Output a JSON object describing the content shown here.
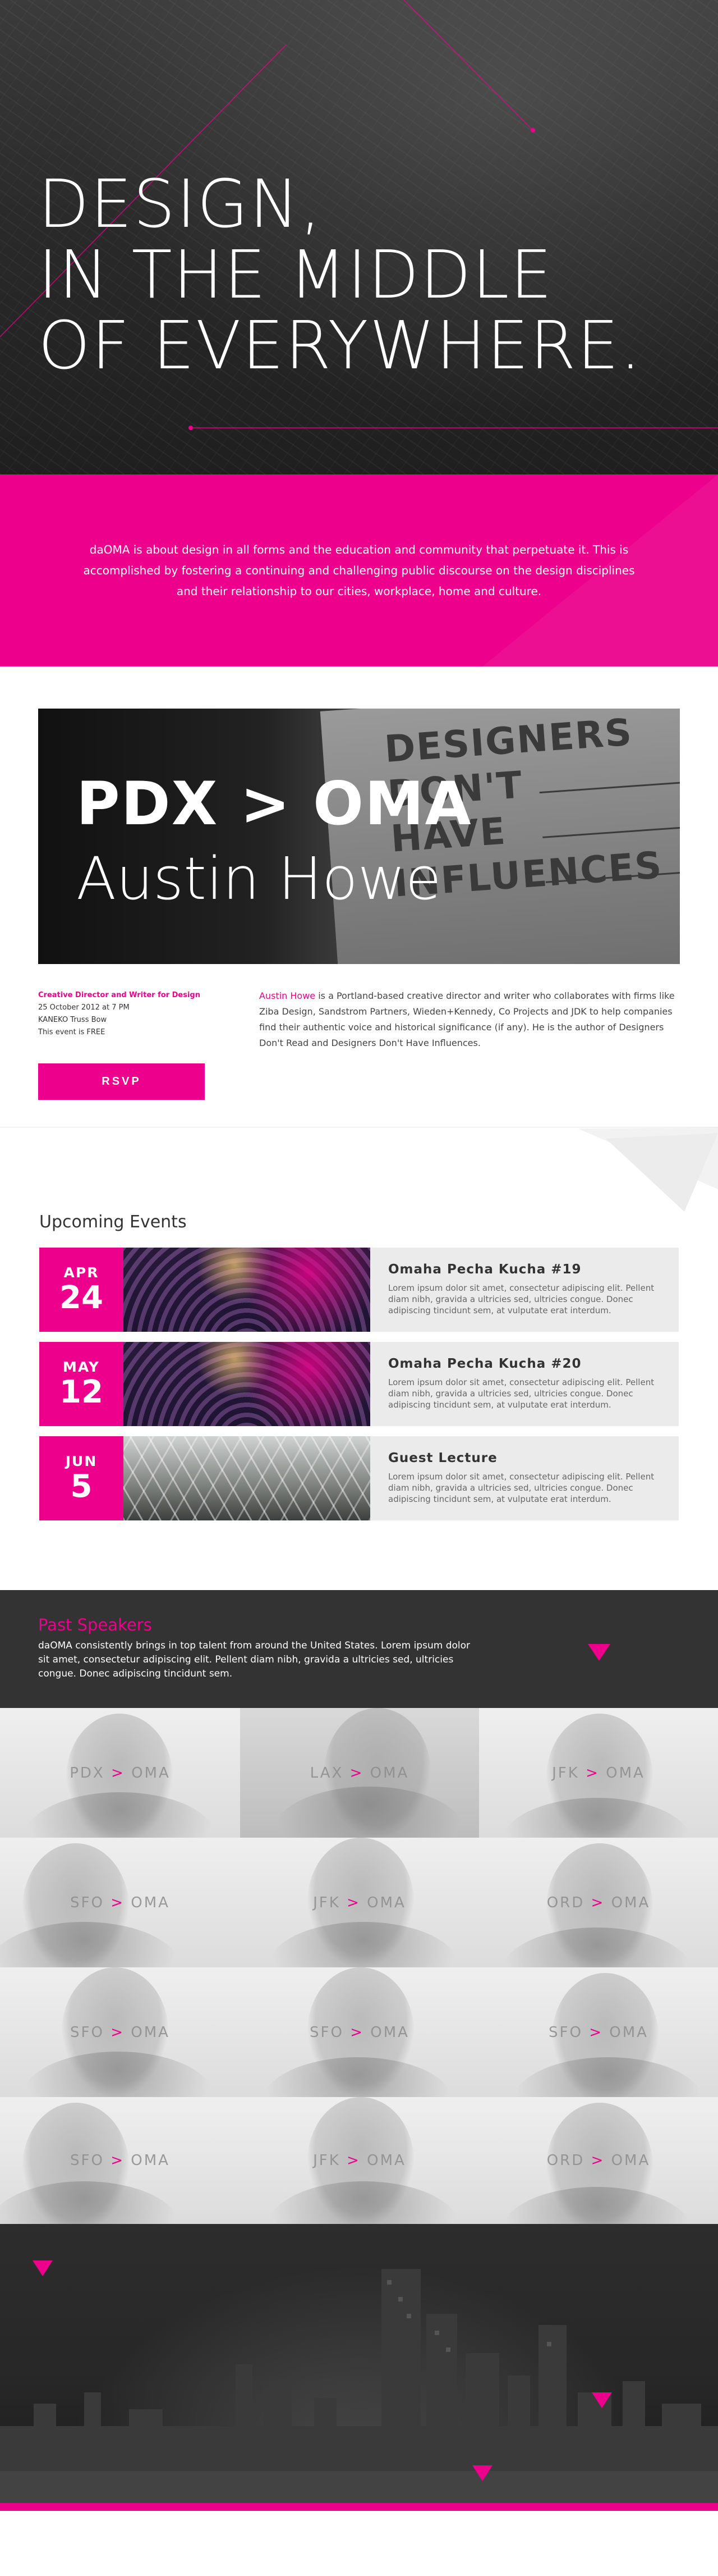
{
  "hero": {
    "line1": "DESIGN,",
    "line2": "IN THE MIDDLE",
    "line3": "OF EVERYWHERE."
  },
  "mission": {
    "text": "daOMA is about design in all forms and the education and community that perpetuate it. This is accomplished by fostering a continuing and challenging public discourse on the design disciplines and their relationship to our cities, workplace, home and culture."
  },
  "feature": {
    "title": "PDX > OMA",
    "speaker": "Austin Howe",
    "sign_words": [
      "DESIGNERS",
      "DON'T",
      "HAVE",
      "INFLUENCES"
    ],
    "role": "Creative Director and Writer for Design",
    "date": "25 October 2012 at 7 PM",
    "venue": "KANEKO Truss Bow",
    "price": "This event is FREE",
    "rsvp_label": "RSVP",
    "bio_name": "Austin Howe",
    "bio_text": " is a Portland-based creative director and writer who collaborates with firms like Ziba Design, Sandstrom Partners, Wieden+Kennedy, Co Projects and JDK to help companies find their authentic voice and historical significance (if any). He is the author of Designers Don't Read and Designers Don't Have Influences."
  },
  "upcoming": {
    "heading": "Upcoming Events",
    "events": [
      {
        "month": "APR",
        "day": "24",
        "title": "Omaha Pecha Kucha #19",
        "desc": "Lorem ipsum dolor sit amet, consectetur adipiscing elit. Pellent diam nibh, gravida a ultricies sed, ultricies congue. Donec adipiscing tincidunt sem, at vulputate erat interdum."
      },
      {
        "month": "MAY",
        "day": "12",
        "title": "Omaha Pecha Kucha #20",
        "desc": "Lorem ipsum dolor sit amet, consectetur adipiscing elit. Pellent diam nibh, gravida a ultricies sed, ultricies congue. Donec adipiscing tincidunt sem, at vulputate erat interdum."
      },
      {
        "month": "JUN",
        "day": "5",
        "title": "Guest Lecture",
        "desc": "Lorem ipsum dolor sit amet, consectetur adipiscing elit. Pellent diam nibh, gravida a ultricies sed, ultricies congue. Donec adipiscing tincidunt sem, at vulputate erat interdum."
      }
    ]
  },
  "past": {
    "heading": "Past Speakers",
    "text": "daOMA consistently brings in top talent from around the United States. Lorem ipsum dolor sit amet, consectetur adipiscing elit. Pellent diam nibh, gravida a ultricies sed, ultricies congue. Donec adipiscing tincidunt sem.",
    "speakers": [
      {
        "from": "PDX",
        "arrow": ">",
        "to": "OMA"
      },
      {
        "from": "LAX",
        "arrow": ">",
        "to": "OMA"
      },
      {
        "from": "JFK",
        "arrow": ">",
        "to": "OMA"
      },
      {
        "from": "SFO",
        "arrow": ">",
        "to": "OMA"
      },
      {
        "from": "JFK",
        "arrow": ">",
        "to": "OMA"
      },
      {
        "from": "ORD",
        "arrow": ">",
        "to": "OMA"
      },
      {
        "from": "SFO",
        "arrow": ">",
        "to": "OMA"
      },
      {
        "from": "SFO",
        "arrow": ">",
        "to": "OMA"
      },
      {
        "from": "SFO",
        "arrow": ">",
        "to": "OMA"
      },
      {
        "from": "SFO",
        "arrow": ">",
        "to": "OMA"
      },
      {
        "from": "JFK",
        "arrow": ">",
        "to": "OMA"
      },
      {
        "from": "ORD",
        "arrow": ">",
        "to": "OMA"
      }
    ]
  },
  "colors": {
    "accent": "#ec008c",
    "dark": "#333333",
    "event_bg": "#ebebeb"
  }
}
